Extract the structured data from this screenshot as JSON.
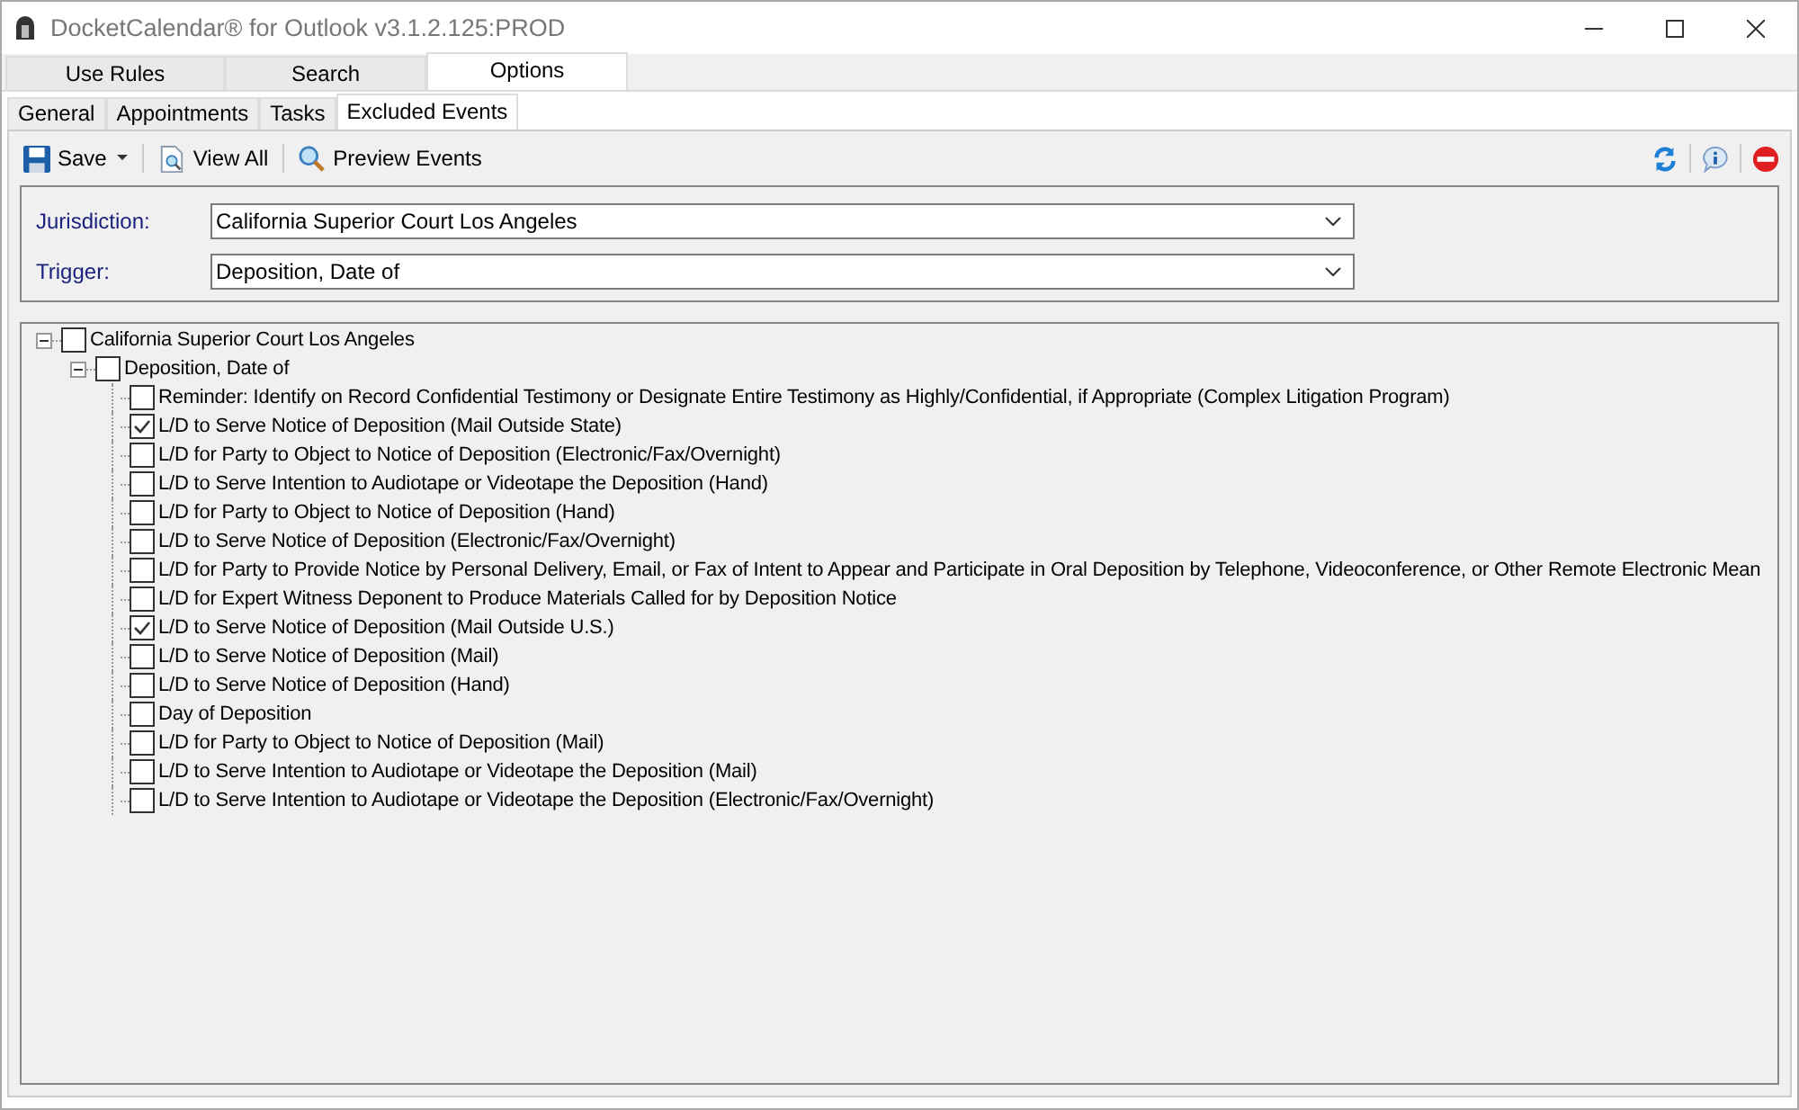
{
  "window": {
    "title": "DocketCalendar® for Outlook v3.1.2.125:PROD"
  },
  "tabs": [
    {
      "label": "Use Rules",
      "selected": false
    },
    {
      "label": "Search",
      "selected": false
    },
    {
      "label": "Options",
      "selected": true
    }
  ],
  "subtabs": [
    {
      "label": "General",
      "selected": false
    },
    {
      "label": "Appointments",
      "selected": false
    },
    {
      "label": "Tasks",
      "selected": false
    },
    {
      "label": "Excluded Events",
      "selected": true
    }
  ],
  "toolbar": {
    "save": "Save",
    "view_all": "View All",
    "preview": "Preview Events"
  },
  "form": [
    {
      "label": "Jurisdiction:",
      "value": "California Superior Court Los Angeles"
    },
    {
      "label": "Trigger:",
      "value": "Deposition, Date of"
    }
  ],
  "tree": [
    {
      "label": "California Superior Court Los Angeles",
      "checked": false,
      "expanded": true,
      "children": [
        {
          "label": "Deposition, Date of",
          "checked": false,
          "expanded": true,
          "children": [
            {
              "label": "Reminder: Identify on Record Confidential Testimony or Designate Entire Testimony as Highly/Confidential, if Appropriate (Complex Litigation Program)",
              "checked": false
            },
            {
              "label": "L/D to Serve Notice of Deposition (Mail Outside State)",
              "checked": true
            },
            {
              "label": "L/D for Party to Object to Notice of Deposition (Electronic/Fax/Overnight)",
              "checked": false
            },
            {
              "label": "L/D to Serve Intention to Audiotape or Videotape the Deposition (Hand)",
              "checked": false
            },
            {
              "label": "L/D for Party to Object to Notice of Deposition (Hand)",
              "checked": false
            },
            {
              "label": "L/D to Serve Notice of Deposition (Electronic/Fax/Overnight)",
              "checked": false
            },
            {
              "label": "L/D for Party to Provide Notice by Personal Delivery, Email, or Fax of Intent to Appear and Participate in Oral Deposition by Telephone, Videoconference, or Other Remote Electronic Mean",
              "checked": false
            },
            {
              "label": "L/D for Expert Witness Deponent to Produce Materials Called for by Deposition Notice",
              "checked": false
            },
            {
              "label": "L/D to Serve Notice of Deposition (Mail Outside U.S.)",
              "checked": true
            },
            {
              "label": "L/D to Serve Notice of Deposition (Mail)",
              "checked": false
            },
            {
              "label": "L/D to Serve Notice of Deposition (Hand)",
              "checked": false
            },
            {
              "label": "Day of Deposition",
              "checked": false
            },
            {
              "label": "L/D for Party to Object to Notice of Deposition (Mail)",
              "checked": false
            },
            {
              "label": "L/D to Serve Intention to Audiotape or Videotape the Deposition (Mail)",
              "checked": false
            },
            {
              "label": "L/D to Serve Intention to Audiotape or Videotape the Deposition (Electronic/Fax/Overnight)",
              "checked": false
            }
          ]
        }
      ]
    }
  ]
}
